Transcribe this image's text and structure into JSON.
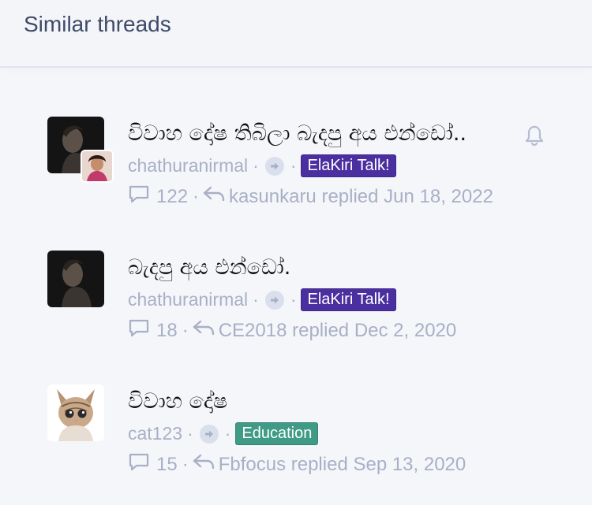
{
  "header": {
    "title": "Similar threads"
  },
  "threads": [
    {
      "title": "විවාහ දෝෂ තිබිලා බැදපු අය එන්ඩෝ..",
      "author": "chathuranirmal",
      "tag": "ElaKiri Talk!",
      "tag_color": "#4a2fa0",
      "replies": "122",
      "last_reply": "kasunkaru replied Jun 18, 2022",
      "watched": true
    },
    {
      "title": "බැදපු අය එන්ඩෝ.",
      "author": "chathuranirmal",
      "tag": "ElaKiri Talk!",
      "tag_color": "#4a2fa0",
      "replies": "18",
      "last_reply": "CE2018 replied Dec 2, 2020",
      "watched": false
    },
    {
      "title": "විවාහ දෝෂ",
      "author": "cat123",
      "tag": "Education",
      "tag_color": "#3f9b86",
      "replies": "15",
      "last_reply": "Fbfocus replied Sep 13, 2020",
      "watched": false
    }
  ],
  "colors": {
    "meta_text": "#a8b0c6",
    "title_text": "#111111",
    "accent_bell": "#b5bdd3"
  }
}
